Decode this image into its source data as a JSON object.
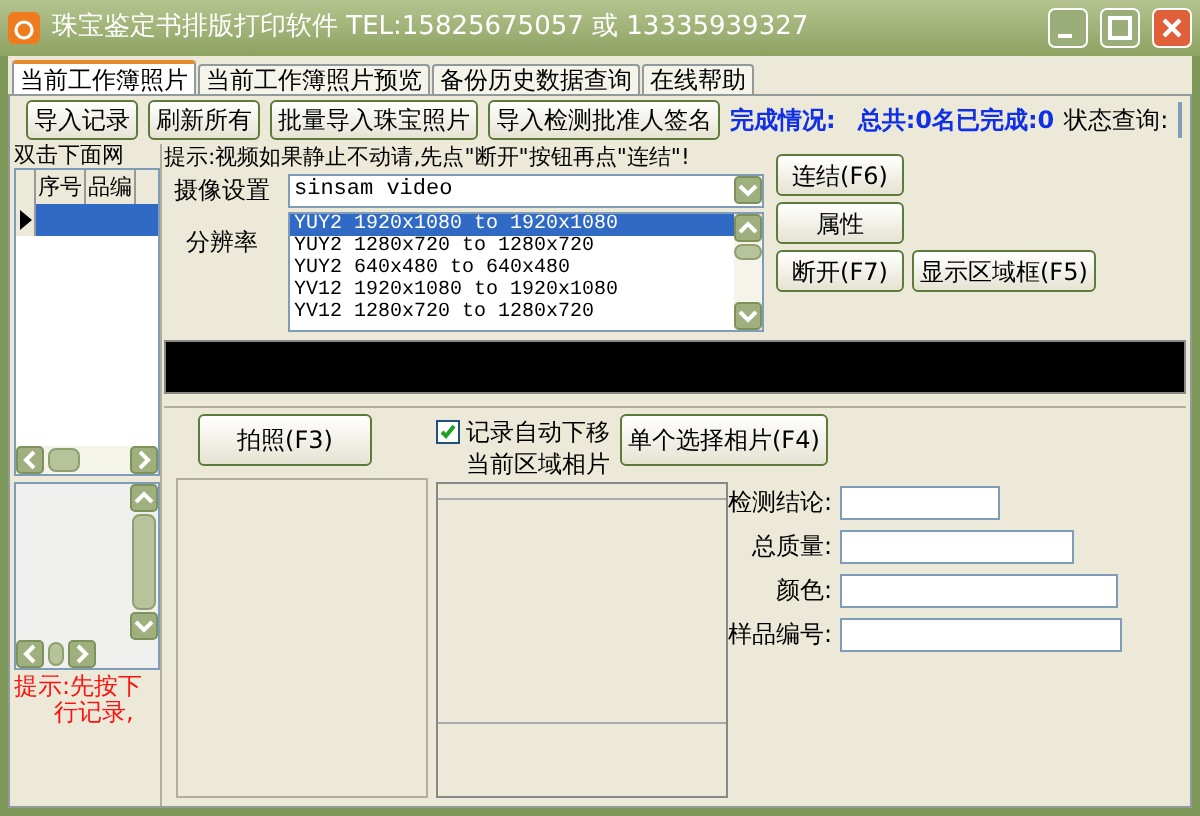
{
  "window": {
    "title": "珠宝鉴定书排版打印软件 TEL:15825675057 或 13335939327"
  },
  "tabs": [
    {
      "label": "当前工作簿照片",
      "selected": true
    },
    {
      "label": "当前工作簿照片预览",
      "selected": false
    },
    {
      "label": "备份历史数据查询",
      "selected": false
    },
    {
      "label": "在线帮助",
      "selected": false
    }
  ],
  "toolbar": {
    "buttons": [
      "导入记录",
      "刷新所有",
      "批量导入珠宝照片",
      "导入检测批准人签名"
    ],
    "completion_label": "完成情况:",
    "summary": "总共:0名已完成:0",
    "status_query_label": "状态查询:"
  },
  "left_panel": {
    "group_label": "双击下面网",
    "grid": {
      "columns": [
        "序号",
        "品编"
      ],
      "rows": [
        {
          "selected": true
        }
      ]
    },
    "hint_lines": [
      "提示:先按下",
      "行记录,"
    ]
  },
  "camera": {
    "hint": "提示:视频如果静止不动请,先点\"断开\"按钮再点\"连结\"!",
    "device_label": "摄像设置",
    "device": "sinsam video",
    "resolution_label": "分辨率",
    "resolutions": [
      {
        "label": "YUY2 1920x1080 to 1920x1080",
        "selected": true
      },
      {
        "label": "YUY2 1280x720 to 1280x720",
        "selected": false
      },
      {
        "label": "YUY2 640x480 to 640x480",
        "selected": false
      },
      {
        "label": "YV12 1920x1080 to 1920x1080",
        "selected": false
      },
      {
        "label": "YV12 1280x720 to 1280x720",
        "selected": false
      }
    ],
    "buttons": [
      "连结(F6)",
      "属性",
      "断开(F7)",
      "显示区域框(F5)"
    ]
  },
  "capture": {
    "capture_button": "拍照(F3)",
    "auto_move": {
      "label": "记录自动下移",
      "checked": true
    },
    "current_label": "当前区域相片",
    "select_button": "单个选择相片(F4)",
    "fields": [
      {
        "label": "检测结论:"
      },
      {
        "label": "总质量:"
      },
      {
        "label": "颜色:"
      },
      {
        "label": "样品编号:"
      }
    ]
  }
}
